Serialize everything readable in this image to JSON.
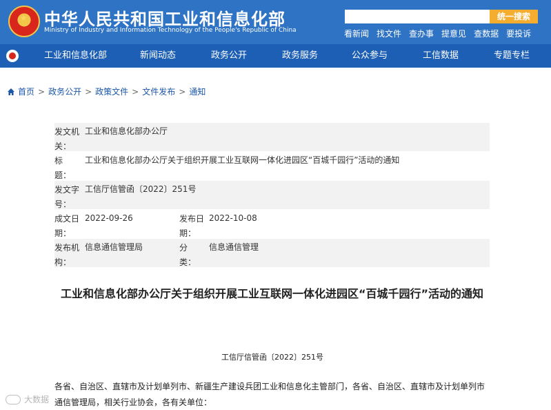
{
  "header": {
    "title": "中华人民共和国工业和信息化部",
    "subtitle": "Ministry of Industry and Information Technology of the People's Republic of China",
    "search_placeholder": "",
    "search_button": "统一搜索",
    "quick_links": [
      "看新闻",
      "找文件",
      "查办事",
      "提意见",
      "查数据",
      "要投诉"
    ]
  },
  "nav": {
    "items": [
      "工业和信息化部",
      "新闻动态",
      "政务公开",
      "政务服务",
      "公众参与",
      "工信数据",
      "专题专栏"
    ]
  },
  "breadcrumb": [
    "首页",
    "政务公开",
    "政策文件",
    "文件发布",
    "通知"
  ],
  "meta": {
    "issuer_label": "发文机关：",
    "issuer": "工业和信息化部办公厅",
    "title_label": "标　　题：",
    "title": "工业和信息化部办公厅关于组织开展工业互联网一体化进园区“百城千园行”活动的通知",
    "docno_label": "发文字号：",
    "docno": "工信厅信管函〔2022〕251号",
    "created_label": "成文日期：",
    "created": "2022-09-26",
    "published_label": "发布日期：",
    "published": "2022-10-08",
    "publisher_label": "发布机构：",
    "publisher": "信息通信管理局",
    "category_label": "分　　类：",
    "category": "信息通信管理"
  },
  "article": {
    "title": "工业和信息化部办公厅关于组织开展工业互联网一体化进园区“百城千园行”活动的通知",
    "doc_no": "工信厅信管函〔2022〕251号",
    "body": "各省、自治区、直辖市及计划单列市、新疆生产建设兵团工业和信息化主管部门，各省、自治区、直辖市及计划单列市通信管理局，相关行业协会，各有关单位："
  },
  "watermark": "大数据"
}
